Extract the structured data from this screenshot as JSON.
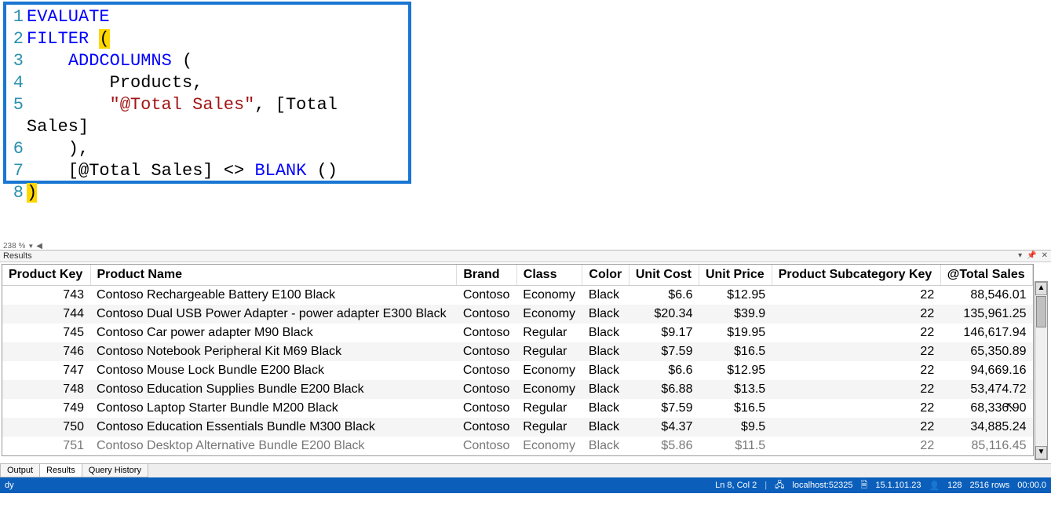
{
  "editor": {
    "zoom_label": "238 %",
    "lines": [
      {
        "n": "1",
        "html": "<span class='tok-kw'>EVALUATE</span>"
      },
      {
        "n": "2",
        "html": "<span class='tok-kw'>FILTER</span> <span class='hi-paren'>(</span>"
      },
      {
        "n": "3",
        "html": "&nbsp;&nbsp;&nbsp;&nbsp;<span class='tok-fn'>ADDCOLUMNS</span> ("
      },
      {
        "n": "4",
        "html": "&nbsp;&nbsp;&nbsp;&nbsp;&nbsp;&nbsp;&nbsp;&nbsp;Products,"
      },
      {
        "n": "5",
        "html": "&nbsp;&nbsp;&nbsp;&nbsp;&nbsp;&nbsp;&nbsp;&nbsp;<span class='tok-str'>\"@Total Sales\"</span>, [Total Sales]"
      },
      {
        "n": "6",
        "html": "&nbsp;&nbsp;&nbsp;&nbsp;),"
      },
      {
        "n": "7",
        "html": "&nbsp;&nbsp;&nbsp;&nbsp;[@Total Sales] &lt;&gt; <span class='tok-fn'>BLANK</span> ()"
      },
      {
        "n": "8",
        "html": "<span class='hi-paren'>)</span>"
      }
    ]
  },
  "results_panel": {
    "title": "Results",
    "columns": [
      "Product Key",
      "Product Name",
      "Brand",
      "Class",
      "Color",
      "Unit Cost",
      "Unit Price",
      "Product Subcategory Key",
      "@Total Sales"
    ],
    "rows": [
      [
        "743",
        "Contoso Rechargeable Battery E100 Black",
        "Contoso",
        "Economy",
        "Black",
        "$6.6",
        "$12.95",
        "22",
        "88,546.01"
      ],
      [
        "744",
        "Contoso Dual USB Power Adapter - power adapter E300 Black",
        "Contoso",
        "Economy",
        "Black",
        "$20.34",
        "$39.9",
        "22",
        "135,961.25"
      ],
      [
        "745",
        "Contoso Car power adapter M90 Black",
        "Contoso",
        "Regular",
        "Black",
        "$9.17",
        "$19.95",
        "22",
        "146,617.94"
      ],
      [
        "746",
        "Contoso Notebook Peripheral Kit M69 Black",
        "Contoso",
        "Regular",
        "Black",
        "$7.59",
        "$16.5",
        "22",
        "65,350.89"
      ],
      [
        "747",
        "Contoso Mouse Lock Bundle E200 Black",
        "Contoso",
        "Economy",
        "Black",
        "$6.6",
        "$12.95",
        "22",
        "94,669.16"
      ],
      [
        "748",
        "Contoso Education Supplies Bundle E200 Black",
        "Contoso",
        "Economy",
        "Black",
        "$6.88",
        "$13.5",
        "22",
        "53,474.72"
      ],
      [
        "749",
        "Contoso Laptop Starter Bundle M200 Black",
        "Contoso",
        "Regular",
        "Black",
        "$7.59",
        "$16.5",
        "22",
        "68,336.90"
      ],
      [
        "750",
        "Contoso Education Essentials Bundle M300 Black",
        "Contoso",
        "Regular",
        "Black",
        "$4.37",
        "$9.5",
        "22",
        "34,885.24"
      ],
      [
        "751",
        "Contoso Desktop Alternative Bundle E200 Black",
        "Contoso",
        "Economy",
        "Black",
        "$5.86",
        "$11.5",
        "22",
        "85,116.45"
      ]
    ]
  },
  "tabs": {
    "output": "Output",
    "results": "Results",
    "history": "Query History"
  },
  "status": {
    "left": "dy",
    "pos": "Ln 8, Col 2",
    "server": "localhost:52325",
    "version": "15.1.101.23",
    "users": "128",
    "rows": "2516 rows",
    "time": "00:00.0"
  }
}
